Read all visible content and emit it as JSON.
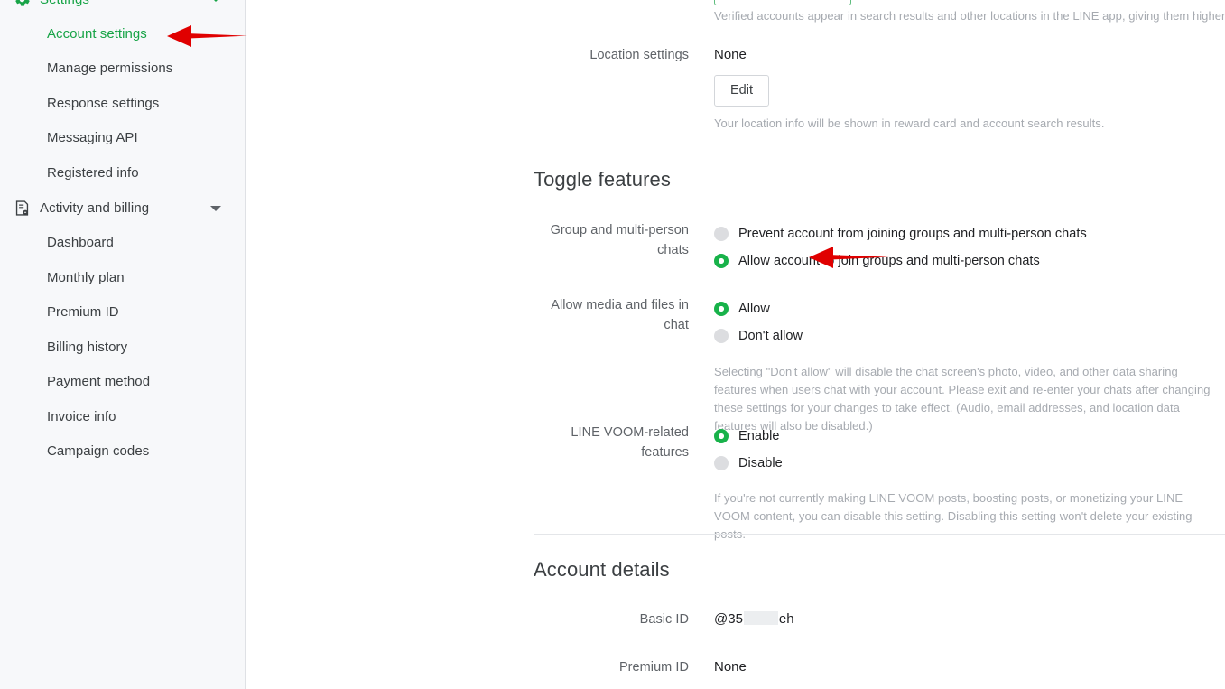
{
  "sidebar": {
    "groups": [
      {
        "label": "Settings",
        "icon": "gear-icon",
        "active": true,
        "expanded": true,
        "items": [
          {
            "label": "Account settings",
            "selected": true
          },
          {
            "label": "Manage permissions",
            "selected": false
          },
          {
            "label": "Response settings",
            "selected": false
          },
          {
            "label": "Messaging API",
            "selected": false
          },
          {
            "label": "Registered info",
            "selected": false
          }
        ]
      },
      {
        "label": "Activity and billing",
        "icon": "document-billing-icon",
        "active": false,
        "expanded": true,
        "items": [
          {
            "label": "Dashboard",
            "selected": false
          },
          {
            "label": "Monthly plan",
            "selected": false
          },
          {
            "label": "Premium ID",
            "selected": false
          },
          {
            "label": "Billing history",
            "selected": false
          },
          {
            "label": "Payment method",
            "selected": false
          },
          {
            "label": "Invoice info",
            "selected": false
          },
          {
            "label": "Campaign codes",
            "selected": false
          }
        ]
      }
    ]
  },
  "main": {
    "verified_help": "Verified accounts appear in search results and other locations in the LINE app, giving them higher visibility.",
    "location": {
      "label": "Location settings",
      "value": "None",
      "edit_label": "Edit",
      "help": "Your location info will be shown in reward card and account search results."
    },
    "toggle_features": {
      "title": "Toggle features",
      "group_chats": {
        "label": "Group and multi-person chats",
        "options": [
          {
            "label": "Prevent account from joining groups and multi-person chats",
            "selected": false
          },
          {
            "label": "Allow account to join groups and multi-person chats",
            "selected": true
          }
        ]
      },
      "media_files": {
        "label": "Allow media and files in chat",
        "options": [
          {
            "label": "Allow",
            "selected": true
          },
          {
            "label": "Don't allow",
            "selected": false
          }
        ],
        "help": "Selecting \"Don't allow\" will disable the chat screen's photo, video, and other data sharing features when users chat with your account. Please exit and re-enter your chats after changing these settings for your changes to take effect. (Audio, email addresses, and location data features will also be disabled.)"
      },
      "line_voom": {
        "label": "LINE VOOM-related features",
        "options": [
          {
            "label": "Enable",
            "selected": true
          },
          {
            "label": "Disable",
            "selected": false
          }
        ],
        "help": "If you're not currently making LINE VOOM posts, boosting posts, or monetizing your LINE VOOM content, you can disable this setting. Disabling this setting won't delete your existing posts."
      }
    },
    "account_details": {
      "title": "Account details",
      "basic_id": {
        "label": "Basic ID",
        "prefix": "@35",
        "suffix": "eh"
      },
      "premium_id": {
        "label": "Premium ID",
        "value": "None"
      }
    }
  },
  "annotations": {
    "accent_red": "#e00000",
    "arrows": [
      {
        "name": "arrow-to-account-settings"
      },
      {
        "name": "arrow-to-allow-groups-option"
      }
    ]
  },
  "colors": {
    "brand_green": "#18a447",
    "radio_green": "#18b24a",
    "sidebar_bg": "#f7f8fa",
    "text_primary": "#202124",
    "text_secondary": "#5f6368",
    "help_text": "#a6aab0"
  }
}
